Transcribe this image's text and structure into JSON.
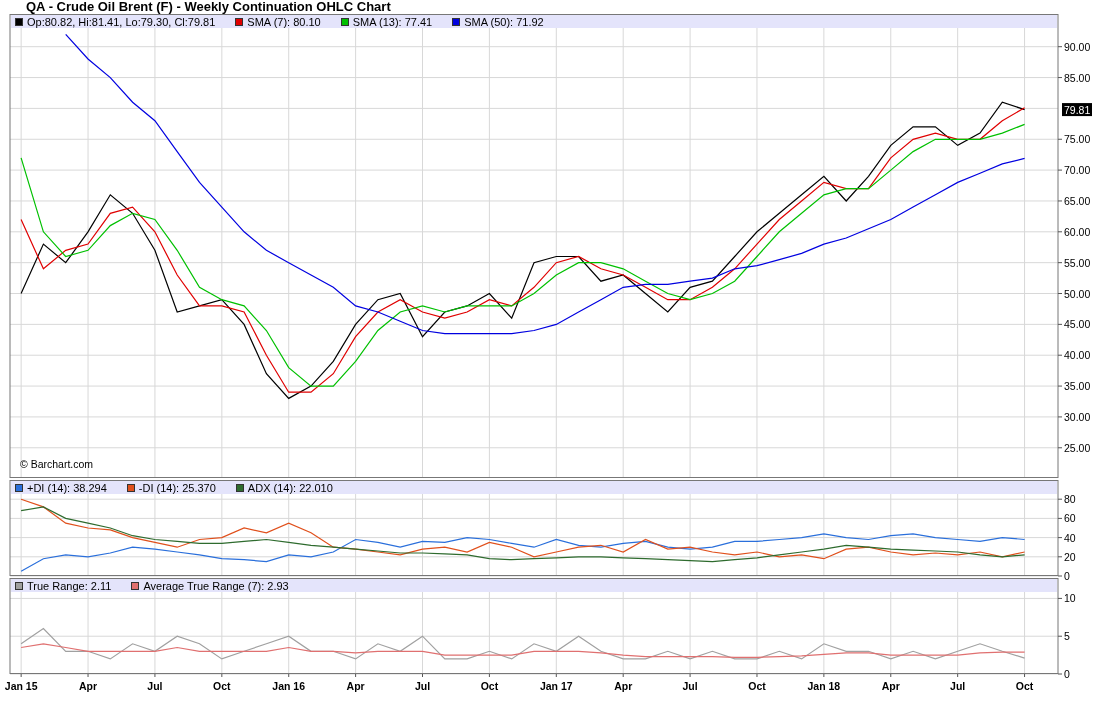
{
  "title": "QA - Crude Oil Brent (F) - Weekly Continuation OHLC Chart",
  "panels": [
    {
      "legend": [
        {
          "label": "Op:80.82, Hi:81.41, Lo:79.30, Cl:79.81",
          "color": "#000000"
        },
        {
          "label": "SMA (7): 80.10",
          "color": "#e00000"
        },
        {
          "label": "SMA (13): 77.41",
          "color": "#00c000"
        },
        {
          "label": "SMA (50): 71.92",
          "color": "#0000e0"
        }
      ],
      "credit": "© Barchart.com",
      "last_price": "79.81",
      "chart_data": {
        "type": "line",
        "grid": true,
        "ylim": [
          20.1,
          95.3
        ],
        "yticks": [
          {
            "value": 25,
            "label": "25.00"
          },
          {
            "value": 30,
            "label": "30.00"
          },
          {
            "value": 35,
            "label": "35.00"
          },
          {
            "value": 40,
            "label": "40.00"
          },
          {
            "value": 45,
            "label": "45.00"
          },
          {
            "value": 50,
            "label": "50.00"
          },
          {
            "value": 55,
            "label": "55.00"
          },
          {
            "value": 60,
            "label": "60.00"
          },
          {
            "value": 65,
            "label": "65.00"
          },
          {
            "value": 70,
            "label": "70.00"
          },
          {
            "value": 75,
            "label": "75.00"
          },
          {
            "value": 85,
            "label": "85.00"
          },
          {
            "value": 90,
            "label": "90.00"
          }
        ],
        "categories": [
          null,
          null,
          null,
          null,
          null,
          null,
          null,
          null,
          null,
          null,
          null,
          null,
          null,
          null,
          null,
          null,
          null,
          null,
          null,
          null,
          null,
          null,
          null,
          null,
          null,
          null,
          null,
          null,
          null,
          null,
          null,
          null,
          null,
          null,
          null,
          null,
          null,
          null,
          null,
          null,
          null,
          null,
          null,
          null,
          null,
          null,
          null
        ],
        "series": [
          {
            "color": "#000000",
            "values": [
              50,
              58,
              55,
              60,
              66,
              63,
              57,
              47,
              48,
              49,
              45,
              37,
              33,
              35,
              39,
              45,
              49,
              50,
              43,
              47,
              48,
              50,
              46,
              55,
              56,
              56,
              52,
              53,
              50,
              47,
              51,
              52,
              56,
              60,
              63,
              66,
              69,
              65,
              69,
              74,
              77,
              77,
              74,
              76,
              81,
              79.8,
              null
            ]
          },
          {
            "color": "#e00000",
            "values": [
              62,
              54,
              57,
              58,
              63,
              64,
              60,
              53,
              48,
              48,
              47,
              40,
              34,
              34,
              37,
              43,
              47,
              49,
              47,
              46,
              47,
              49,
              48,
              51,
              55,
              56,
              54,
              53,
              51,
              49,
              49,
              51,
              54,
              58,
              62,
              65,
              68,
              67,
              67,
              72,
              75,
              76,
              75,
              75,
              78,
              80.1,
              null
            ]
          },
          {
            "color": "#00c000",
            "values": [
              72,
              60,
              56,
              57,
              61,
              63,
              62,
              57,
              51,
              49,
              48,
              44,
              38,
              35,
              35,
              39,
              44,
              47,
              48,
              47,
              48,
              48,
              48,
              50,
              53,
              55,
              55,
              54,
              52,
              50,
              49,
              50,
              52,
              56,
              60,
              63,
              66,
              67,
              67,
              70,
              73,
              75,
              75,
              75,
              76,
              77.4,
              null
            ]
          },
          {
            "color": "#0000e0",
            "values": [
              null,
              null,
              92,
              88,
              85,
              81,
              78,
              73,
              68,
              64,
              60,
              57,
              55,
              53,
              51,
              48,
              47,
              45.5,
              44,
              43.5,
              43.5,
              43.5,
              43.5,
              44,
              45,
              47,
              49,
              51,
              51.5,
              51.5,
              52,
              52.5,
              54,
              54.5,
              55.5,
              56.5,
              58,
              59,
              60.5,
              62,
              64,
              66,
              68,
              69.5,
              71,
              71.9,
              null
            ]
          }
        ]
      }
    },
    {
      "legend": [
        {
          "label": "+DI (14): 38.294",
          "color": "#2a6fdb"
        },
        {
          "label": "-DI (14): 25.370",
          "color": "#e0501c"
        },
        {
          "label": "ADX (14): 22.010",
          "color": "#2e6b2e"
        }
      ],
      "chart_data": {
        "type": "line",
        "grid": true,
        "ylim": [
          0,
          100
        ],
        "yticks": [
          {
            "value": 0,
            "label": "0"
          },
          {
            "value": 20,
            "label": "20"
          },
          {
            "value": 40,
            "label": "40"
          },
          {
            "value": 60,
            "label": "60"
          },
          {
            "value": 80,
            "label": "80"
          }
        ],
        "categories": [
          null,
          null,
          null,
          null,
          null,
          null,
          null,
          null,
          null,
          null,
          null,
          null,
          null,
          null,
          null,
          null,
          null,
          null,
          null,
          null,
          null,
          null,
          null,
          null,
          null,
          null,
          null,
          null,
          null,
          null,
          null,
          null,
          null,
          null,
          null,
          null,
          null,
          null,
          null,
          null,
          null,
          null,
          null,
          null,
          null,
          null,
          null
        ],
        "series": [
          {
            "color": "#2a6fdb",
            "values": [
              5,
              18,
              22,
              20,
              24,
              30,
              28,
              25,
              22,
              18,
              17,
              15,
              22,
              20,
              25,
              38,
              35,
              30,
              36,
              35,
              40,
              38,
              34,
              30,
              38,
              32,
              30,
              34,
              36,
              30,
              28,
              30,
              36,
              36,
              38,
              40,
              44,
              40,
              38,
              42,
              44,
              40,
              38,
              36,
              40,
              38,
              null
            ]
          },
          {
            "color": "#e0501c",
            "values": [
              80,
              72,
              55,
              50,
              48,
              40,
              35,
              30,
              38,
              40,
              50,
              45,
              55,
              45,
              30,
              28,
              25,
              22,
              28,
              30,
              25,
              35,
              30,
              20,
              25,
              30,
              32,
              25,
              38,
              28,
              30,
              25,
              22,
              25,
              20,
              22,
              18,
              28,
              30,
              25,
              22,
              24,
              22,
              25,
              20,
              25,
              null
            ]
          },
          {
            "color": "#2e6b2e",
            "values": [
              68,
              72,
              60,
              55,
              50,
              42,
              38,
              36,
              34,
              34,
              36,
              38,
              35,
              32,
              30,
              28,
              26,
              24,
              24,
              23,
              22,
              18,
              17,
              18,
              19,
              20,
              20,
              19,
              18,
              17,
              16,
              15,
              17,
              19,
              22,
              25,
              28,
              32,
              30,
              28,
              27,
              26,
              25,
              22,
              20,
              22,
              null
            ]
          }
        ]
      }
    },
    {
      "legend": [
        {
          "label": "True Range: 2.11",
          "color": "#a0a0a0"
        },
        {
          "label": "Average True Range (7): 2.93",
          "color": "#e07070"
        }
      ],
      "chart_data": {
        "type": "line",
        "grid": true,
        "ylim": [
          0,
          12.7
        ],
        "yticks": [
          {
            "value": 0,
            "label": "0"
          },
          {
            "value": 5,
            "label": "5"
          },
          {
            "value": 10,
            "label": "10"
          }
        ],
        "categories": [
          "Jan 15",
          null,
          null,
          "Apr",
          null,
          null,
          "Jul",
          null,
          null,
          "Oct",
          null,
          null,
          "Jan 16",
          null,
          null,
          "Apr",
          null,
          null,
          "Jul",
          null,
          null,
          "Oct",
          null,
          null,
          "Jan 17",
          null,
          null,
          "Apr",
          null,
          null,
          "Jul",
          null,
          null,
          "Oct",
          null,
          null,
          "Jan 18",
          null,
          null,
          "Apr",
          null,
          null,
          "Jul",
          null,
          null,
          "Oct",
          null
        ],
        "series": [
          {
            "color": "#a0a0a0",
            "values": [
              4,
              6,
              3,
              3,
              2,
              4,
              3,
              5,
              4,
              2,
              3,
              4,
              5,
              3,
              3,
              2,
              4,
              3,
              5,
              2,
              2,
              3,
              2,
              4,
              3,
              5,
              3,
              2,
              2,
              3,
              2,
              3,
              2,
              2,
              3,
              2,
              4,
              3,
              3,
              2,
              3,
              2,
              3,
              4,
              3,
              2.1,
              null
            ]
          },
          {
            "color": "#e07070",
            "values": [
              3.5,
              4,
              3.5,
              3,
              3,
              3,
              3,
              3.5,
              3,
              3,
              3,
              3,
              3.5,
              3,
              3,
              2.8,
              3,
              3,
              3,
              2.5,
              2.5,
              2.5,
              2.5,
              3,
              3,
              3,
              2.8,
              2.5,
              2.3,
              2.3,
              2.3,
              2.3,
              2.2,
              2.2,
              2.3,
              2.4,
              2.6,
              2.8,
              2.8,
              2.5,
              2.5,
              2.5,
              2.5,
              2.8,
              2.9,
              2.9,
              null
            ]
          }
        ]
      }
    }
  ]
}
